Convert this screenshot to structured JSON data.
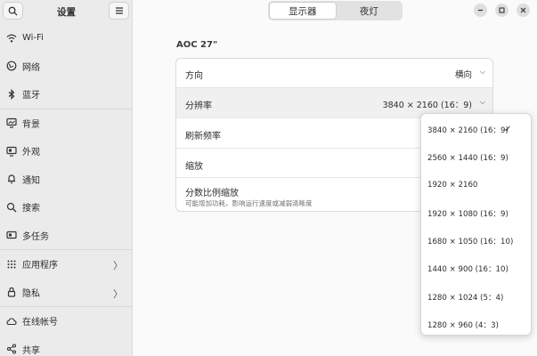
{
  "sidebar": {
    "title": "设置",
    "items": [
      {
        "label": "Wi-Fi",
        "icon": "wifi-icon"
      },
      {
        "label": "网络",
        "icon": "globe-icon"
      },
      {
        "label": "蓝牙",
        "icon": "bluetooth-icon"
      },
      {
        "label": "背景",
        "icon": "monitor-icon"
      },
      {
        "label": "外观",
        "icon": "appearance-icon"
      },
      {
        "label": "通知",
        "icon": "bell-icon"
      },
      {
        "label": "搜索",
        "icon": "search-icon"
      },
      {
        "label": "多任务",
        "icon": "multitask-icon"
      },
      {
        "label": "应用程序",
        "icon": "apps-grid-icon"
      },
      {
        "label": "隐私",
        "icon": "lock-icon"
      },
      {
        "label": "在线帐号",
        "icon": "cloud-icon"
      },
      {
        "label": "共享",
        "icon": "share-icon"
      }
    ]
  },
  "header": {
    "tabs": [
      "显示器",
      "夜灯"
    ]
  },
  "display": {
    "monitor_name": "AOC 27\"",
    "rows": [
      {
        "label": "方向",
        "value": "横向"
      },
      {
        "label": "分辨率",
        "value": "3840 × 2160 (16：9)"
      },
      {
        "label": "刷新频率",
        "value": ""
      },
      {
        "label": "缩放",
        "value": ""
      },
      {
        "label": "分数比例缩放",
        "sublabel": "可能增加功耗，影响运行速度或减弱清晰度"
      }
    ]
  },
  "resolution_options": [
    "3840 × 2160 (16：9)",
    "2560 × 1440 (16：9)",
    "1920 × 2160",
    "1920 × 1080 (16：9)",
    "1680 × 1050 (16：10)",
    "1440 × 900 (16：10)",
    "1280 × 1024 (5：4)",
    "1280 × 960 (4：3)"
  ],
  "selected_resolution": "3840 × 2160 (16：9)"
}
